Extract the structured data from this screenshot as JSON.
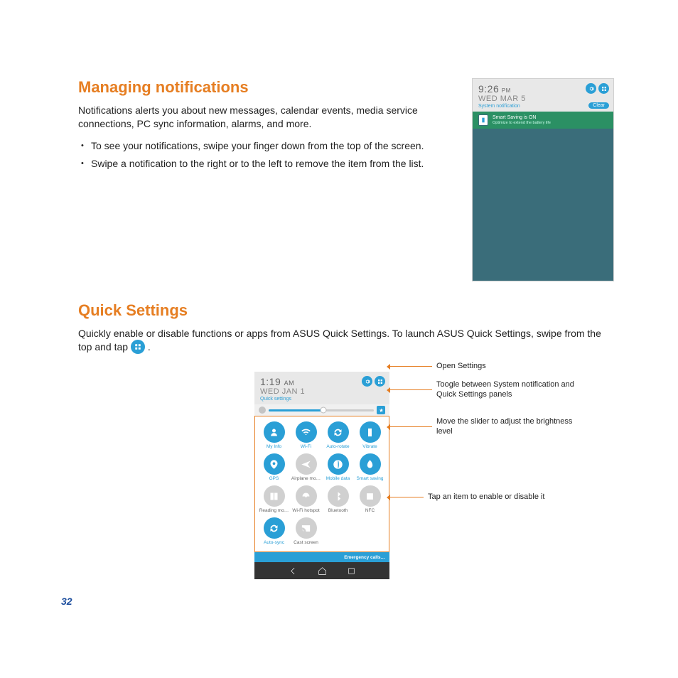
{
  "headings": {
    "managing_notifications": "Managing notifications",
    "quick_settings": "Quick Settings"
  },
  "paragraphs": {
    "notif_intro": "Notifications alerts you about new messages, calendar events, media service connections, PC sync information, alarms, and more.",
    "quick_intro_pre": "Quickly enable or disable functions or apps from ASUS Quick Settings. To launch ASUS Quick Settings, swipe from the top and tap ",
    "quick_intro_post": " ."
  },
  "bullets": {
    "b1": "To see your notifications, swipe your finger down from the top of the screen.",
    "b2": "Swipe a notification to the right or to the left to remove the item from the list."
  },
  "notif_panel": {
    "time_big": "9:26",
    "time_suffix": "PM",
    "date": "WED MAR 5",
    "panel_label": "System notification",
    "clear": "Clear",
    "row_title": "Smart Saving is ON",
    "row_sub": "Optimize to extend the battery life"
  },
  "quick_panel": {
    "time_big": "1:19",
    "time_suffix": "AM",
    "date": "WED JAN 1",
    "panel_label": "Quick settings",
    "status_text": "Emergency calls…",
    "tiles": [
      {
        "label": "My Info",
        "on": true
      },
      {
        "label": "Wi-Fi",
        "on": true
      },
      {
        "label": "Auto-rotate",
        "on": true
      },
      {
        "label": "Vibrate",
        "on": true
      },
      {
        "label": "GPS",
        "on": true
      },
      {
        "label": "Airplane mo…",
        "on": false
      },
      {
        "label": "Mobile data",
        "on": true
      },
      {
        "label": "Smart saving",
        "on": true
      },
      {
        "label": "Reading mo…",
        "on": false
      },
      {
        "label": "Wi-Fi hotspot",
        "on": false
      },
      {
        "label": "Bluetooth",
        "on": false
      },
      {
        "label": "NFC",
        "on": false
      },
      {
        "label": "Auto-sync",
        "on": true
      },
      {
        "label": "Cast screen",
        "on": false
      }
    ]
  },
  "callouts": {
    "c1": "Open Settings",
    "c2": "Toogle between System notification and Quick Settings panels",
    "c3": "Move the slider to adjust the brightness level",
    "c4": "Tap an item to enable or disable it"
  },
  "page_number": "32"
}
